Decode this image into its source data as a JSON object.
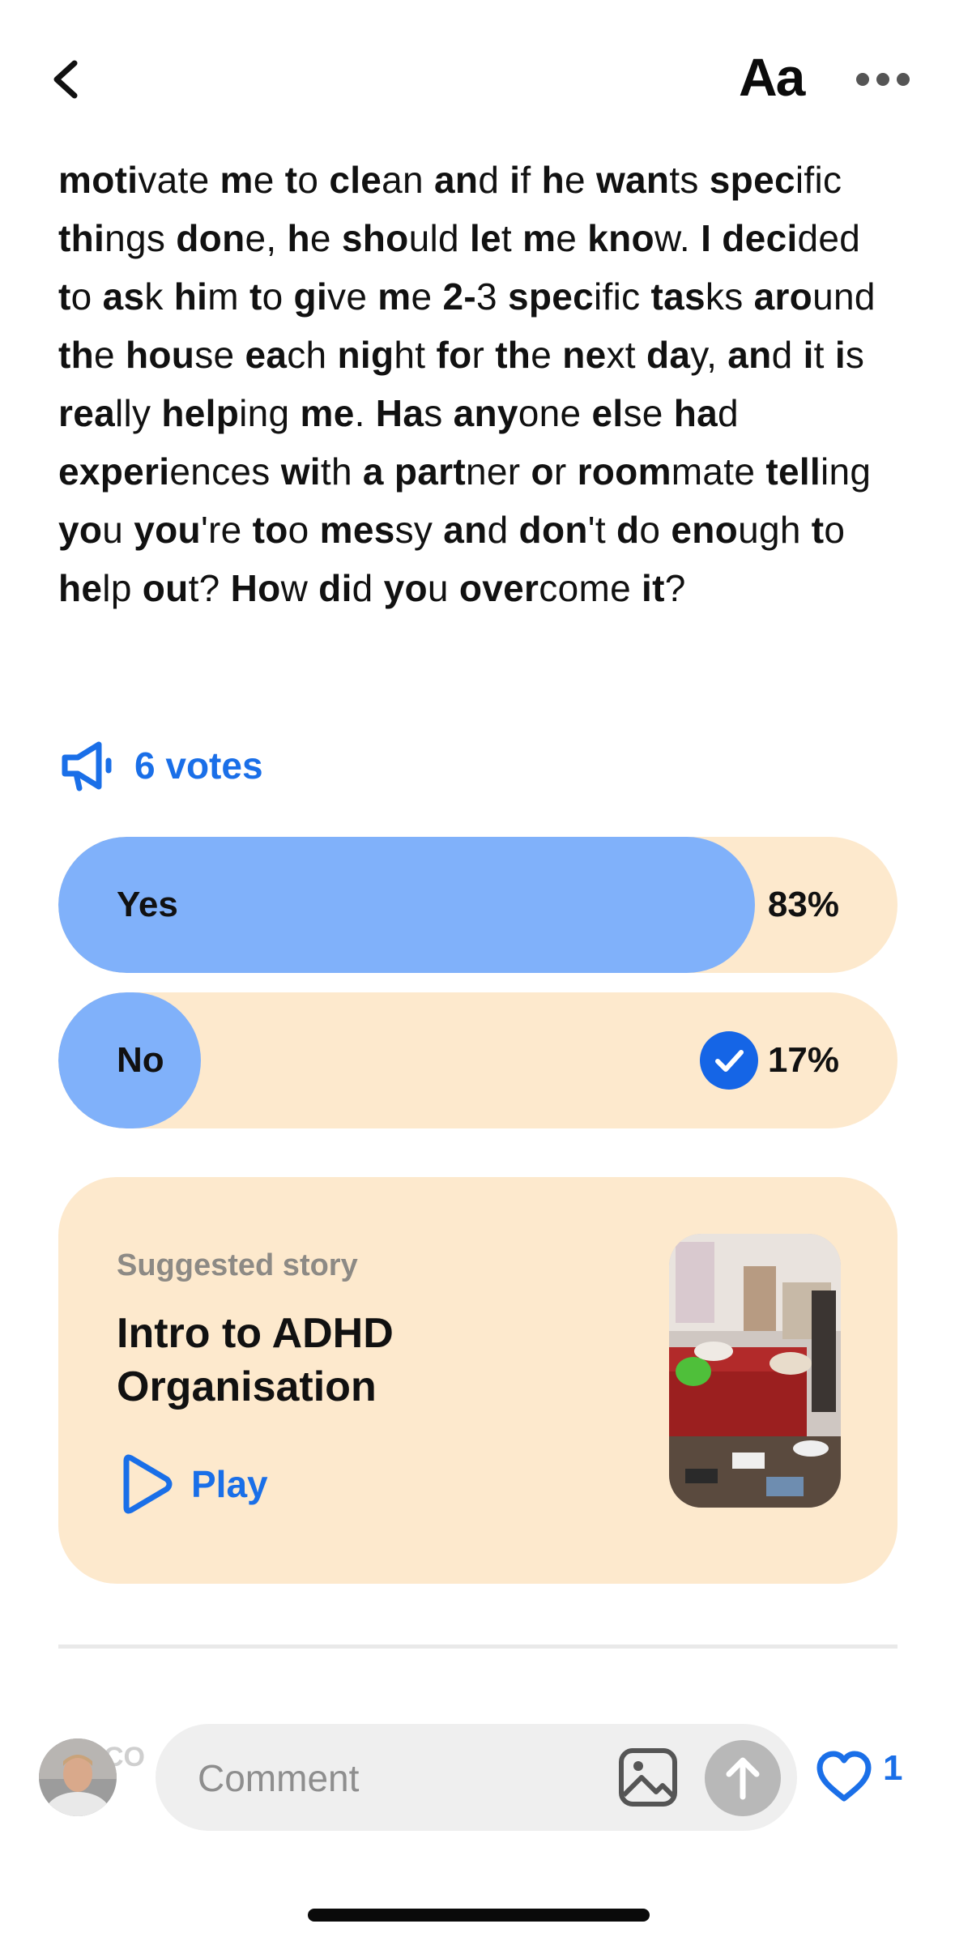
{
  "post": {
    "segments": [
      [
        "moti",
        "vate "
      ],
      [
        "m",
        "e "
      ],
      [
        "t",
        "o "
      ],
      [
        "cle",
        "an "
      ],
      [
        "an",
        "d "
      ],
      [
        "i",
        "f "
      ],
      [
        "h",
        "e "
      ],
      [
        "wan",
        "ts "
      ],
      [
        "spec",
        "ific "
      ],
      [
        "thi",
        "ngs "
      ],
      [
        "don",
        "e, "
      ],
      [
        "h",
        "e "
      ],
      [
        "sho",
        "uld "
      ],
      [
        "le",
        "t "
      ],
      [
        "m",
        "e "
      ],
      [
        "kno",
        "w. "
      ],
      [
        "I",
        ""
      ],
      [
        " deci",
        "ded "
      ],
      [
        "t",
        "o "
      ],
      [
        "as",
        "k "
      ],
      [
        "hi",
        "m "
      ],
      [
        "t",
        "o "
      ],
      [
        "gi",
        "ve "
      ],
      [
        "m",
        "e "
      ],
      [
        "2-",
        "3 "
      ],
      [
        "spec",
        "ific "
      ],
      [
        "tas",
        "ks "
      ],
      [
        "aro",
        "und "
      ],
      [
        "th",
        "e "
      ],
      [
        "hou",
        "se "
      ],
      [
        "ea",
        "ch "
      ],
      [
        "nig",
        "ht "
      ],
      [
        "fo",
        "r "
      ],
      [
        "th",
        "e "
      ],
      [
        "ne",
        "xt "
      ],
      [
        "da",
        "y, "
      ],
      [
        "an",
        "d "
      ],
      [
        "i",
        "t "
      ],
      [
        "i",
        "s "
      ],
      [
        "rea",
        "lly "
      ],
      [
        "help",
        "ing "
      ],
      [
        "me",
        ". "
      ],
      [
        "Ha",
        "s "
      ],
      [
        "any",
        "one "
      ],
      [
        "el",
        "se "
      ],
      [
        "ha",
        "d "
      ],
      [
        "experi",
        "ences "
      ],
      [
        "wi",
        "th "
      ],
      [
        "a",
        " "
      ],
      [
        "part",
        "ner "
      ],
      [
        "o",
        "r "
      ],
      [
        "room",
        "mate "
      ],
      [
        "tell",
        "ing "
      ],
      [
        "yo",
        "u "
      ],
      [
        "you",
        "'re "
      ],
      [
        "to",
        "o "
      ],
      [
        "mes",
        "sy "
      ],
      [
        "an",
        "d "
      ],
      [
        "don",
        "'t "
      ],
      [
        "d",
        "o "
      ],
      [
        "eno",
        "ugh "
      ],
      [
        "t",
        "o "
      ],
      [
        "he",
        "lp "
      ],
      [
        "ou",
        "t? "
      ],
      [
        "Ho",
        "w "
      ],
      [
        "di",
        "d "
      ],
      [
        "yo",
        "u "
      ],
      [
        "over",
        "come "
      ],
      [
        "it",
        "?"
      ]
    ]
  },
  "votes": {
    "label": "6 votes"
  },
  "poll": {
    "options": [
      {
        "label": "Yes",
        "percent_text": "83%",
        "fraction": 0.83,
        "selected": false
      },
      {
        "label": "No",
        "percent_text": "17%",
        "fraction": 0.17,
        "selected": true
      }
    ]
  },
  "story": {
    "kicker": "Suggested story",
    "title": "Intro to ADHD Organisation",
    "play_label": "Play"
  },
  "comment": {
    "placeholder": "Comment",
    "behind_avatar_text": "CO",
    "like_count": "1"
  },
  "colors": {
    "accent": "#1a6fe8",
    "poll_fill": "#80b1fa",
    "card_bg": "#fde9cd"
  },
  "icons": {
    "back": "chevron-left-icon",
    "font": "text-size-icon",
    "more": "more-horizontal-icon",
    "votes": "megaphone-icon",
    "check": "check-circle-icon",
    "play": "play-icon",
    "image": "image-icon",
    "send": "arrow-up-icon",
    "like": "heart-icon"
  }
}
